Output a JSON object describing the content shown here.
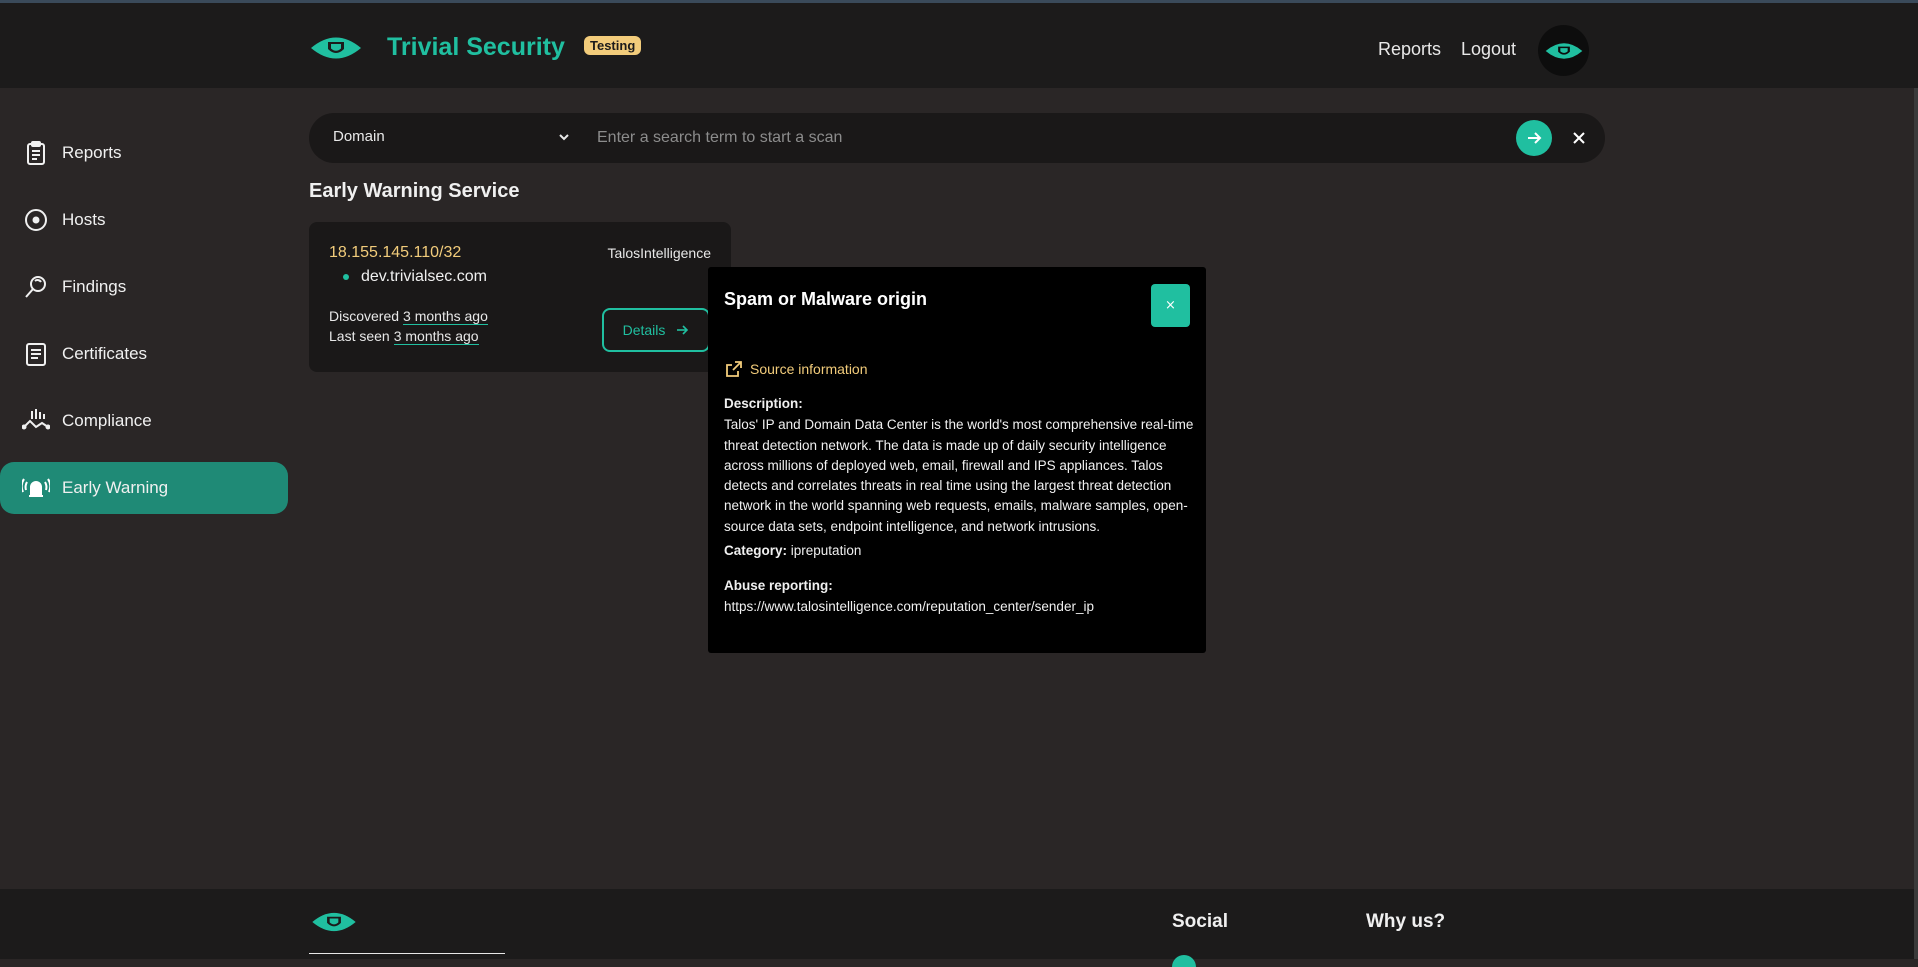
{
  "header": {
    "brand": "Trivial Security",
    "badge": "Testing",
    "nav": [
      {
        "label": "Reports"
      },
      {
        "label": "Logout"
      }
    ]
  },
  "sidebar": {
    "items": [
      {
        "label": "Reports",
        "icon": "clipboard-icon"
      },
      {
        "label": "Hosts",
        "icon": "target-icon"
      },
      {
        "label": "Findings",
        "icon": "search-refresh-icon"
      },
      {
        "label": "Certificates",
        "icon": "document-icon"
      },
      {
        "label": "Compliance",
        "icon": "chart-icon"
      },
      {
        "label": "Early Warning",
        "icon": "alarm-bell-icon",
        "active": true
      }
    ]
  },
  "search": {
    "type": "Domain",
    "placeholder": "Enter a search term to start a scan"
  },
  "main": {
    "title": "Early Warning Service",
    "card": {
      "ip": "18.155.145.110/32",
      "source": "TalosIntelligence",
      "host": "dev.trivialsec.com",
      "discovered_label": "Discovered",
      "discovered_value": "3 months ago",
      "last_seen_label": "Last seen",
      "last_seen_value": "3 months ago",
      "details_label": "Details"
    }
  },
  "modal": {
    "title": "Spam or Malware origin",
    "close_label": "×",
    "source_link": "Source information",
    "description_label": "Description:",
    "description": "Talos' IP and Domain Data Center is the world's most comprehensive real-time threat detection network. The data is made up of daily security intelligence across millions of deployed web, email, firewall and IPS appliances. Talos detects and correlates threats in real time using the largest threat detection network in the world spanning web requests, emails, malware samples, open-source data sets, endpoint intelligence, and network intrusions.",
    "category_label": "Category:",
    "category": "ipreputation",
    "abuse_label": "Abuse reporting:",
    "abuse_url": "https://www.talosintelligence.com/reputation_center/sender_ip"
  },
  "footer": {
    "social": "Social",
    "why": "Why us?"
  },
  "colors": {
    "accent": "#20bfa0",
    "highlight": "#f2cc7b",
    "background": "#2a2626",
    "panel": "#1c1b1b"
  }
}
